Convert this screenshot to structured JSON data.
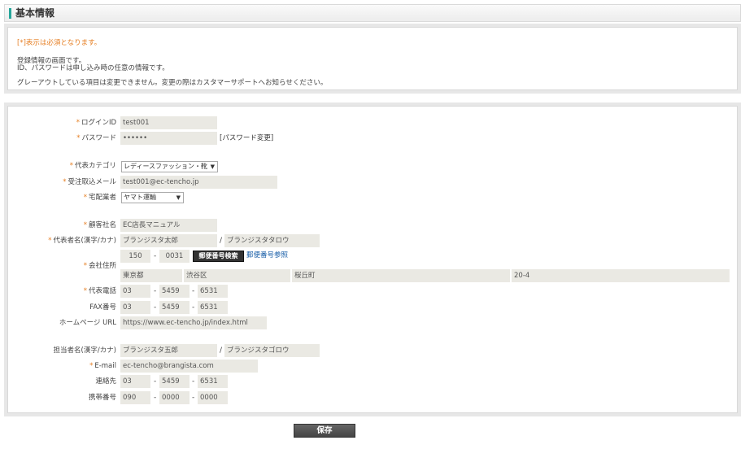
{
  "header": {
    "title": "基本情報"
  },
  "info": {
    "required_note": "[*]表示は必須となります。",
    "line1": "登録情報の画面です。",
    "line2": "ID、パスワードは申し込み時の任意の情報です。",
    "line3": "グレーアウトしている項目は変更できません。変更の際はカスタマーサポートへお知らせください。"
  },
  "form": {
    "required_mark": "*",
    "login_id": {
      "label": "ログインID",
      "value": "test001"
    },
    "password": {
      "label": "パスワード",
      "value": "••••••",
      "change_label": "[パスワード変更]"
    },
    "category": {
      "label": "代表カテゴリ",
      "selected": "レディースファッション・靴"
    },
    "order_email": {
      "label": "受注取込メール",
      "value": "test001@ec-tencho.jp"
    },
    "carrier": {
      "label": "宅配業者",
      "selected": "ヤマト運輸"
    },
    "company_name": {
      "label": "顧客社名",
      "value": "EC店長マニュアル"
    },
    "rep_name": {
      "label": "代表者名(漢字/カナ)",
      "kanji": "ブランジスタ太郎",
      "kana": "ブランジスタタロウ",
      "slash": "/"
    },
    "address": {
      "label": "会社住所",
      "zip1": "150",
      "zip2": "0031",
      "dash": "-",
      "search_button": "郵便番号検索",
      "ref_link": "郵便番号参照",
      "pref": "東京都",
      "city": "渋谷区",
      "town": "桜丘町",
      "street": "20-4"
    },
    "rep_phone": {
      "label": "代表電話",
      "p1": "03",
      "p2": "5459",
      "p3": "6531"
    },
    "fax": {
      "label": "FAX番号",
      "p1": "03",
      "p2": "5459",
      "p3": "6531"
    },
    "homepage": {
      "label": "ホームページ URL",
      "value": "https://www.ec-tencho.jp/index.html"
    },
    "contact_name": {
      "label": "担当者名(漢字/カナ)",
      "kanji": "ブランジスタ五郎",
      "kana": "ブランジスタゴロウ"
    },
    "email": {
      "label": "E-mail",
      "value": "ec-tencho@brangista.com"
    },
    "contact_phone": {
      "label": "連絡先",
      "p1": "03",
      "p2": "5459",
      "p3": "6531"
    },
    "mobile": {
      "label": "携帯番号",
      "p1": "090",
      "p2": "0000",
      "p3": "0000"
    }
  },
  "save_button": "保存"
}
